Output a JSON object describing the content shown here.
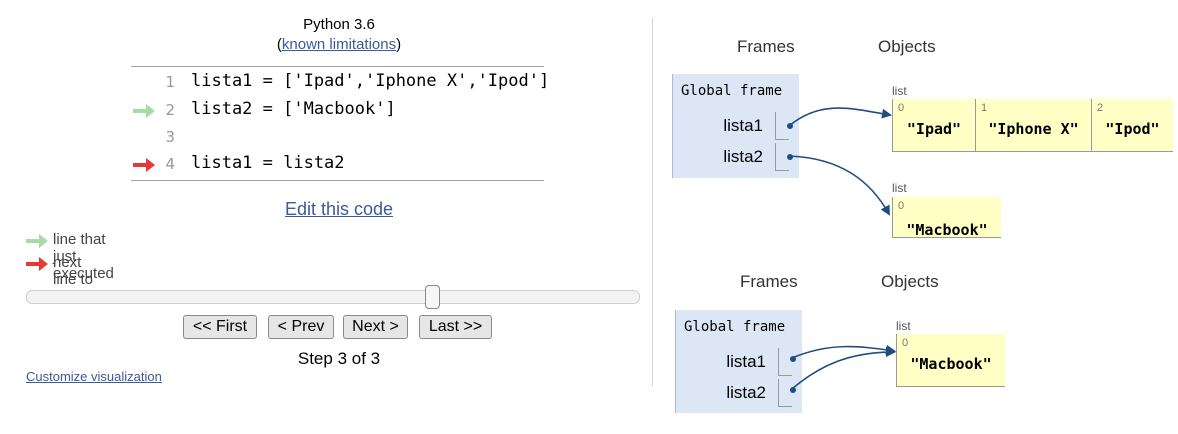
{
  "header": {
    "language": "Python 3.6",
    "limits_prefix": "(",
    "limits_link": "known limitations",
    "limits_suffix": ")"
  },
  "code": {
    "lines": [
      {
        "number": "1",
        "text": "lista1 = ['Ipad','Iphone X','Ipod']",
        "marker": "none"
      },
      {
        "number": "2",
        "text": "lista2 = ['Macbook']",
        "marker": "executed"
      },
      {
        "number": "3",
        "text": "",
        "marker": "none"
      },
      {
        "number": "4",
        "text": "lista1 = lista2",
        "marker": "next"
      }
    ]
  },
  "edit_link": "Edit this code",
  "legend": {
    "executed": "line that just executed",
    "next": "next line to execute"
  },
  "controls": {
    "first": "<< First",
    "prev": "< Prev",
    "next": "Next >",
    "last": "Last >>",
    "step_label": "Step 3 of 3",
    "step_current": 3,
    "step_total": 3
  },
  "customize_link": "Customize visualization",
  "colors": {
    "executed_arrow": "#a6dba6",
    "next_arrow": "#e53935",
    "frame_bg": "#dde6f5",
    "list_bg": "#ffffc6",
    "pointer": "#1f4d80",
    "link": "#3a5a99"
  },
  "viz_top": {
    "frames_label": "Frames",
    "objects_label": "Objects",
    "frame_title": "Global frame",
    "vars": [
      "lista1",
      "lista2"
    ],
    "list_label": "list",
    "list_a": [
      {
        "index": "0",
        "value": "\"Ipad\""
      },
      {
        "index": "1",
        "value": "\"Iphone X\""
      },
      {
        "index": "2",
        "value": "\"Ipod\""
      }
    ],
    "list_b": [
      {
        "index": "0",
        "value": "\"Macbook\""
      }
    ]
  },
  "viz_bottom": {
    "frames_label": "Frames",
    "objects_label": "Objects",
    "frame_title": "Global frame",
    "vars": [
      "lista1",
      "lista2"
    ],
    "list_label": "list",
    "list_b": [
      {
        "index": "0",
        "value": "\"Macbook\""
      }
    ]
  }
}
